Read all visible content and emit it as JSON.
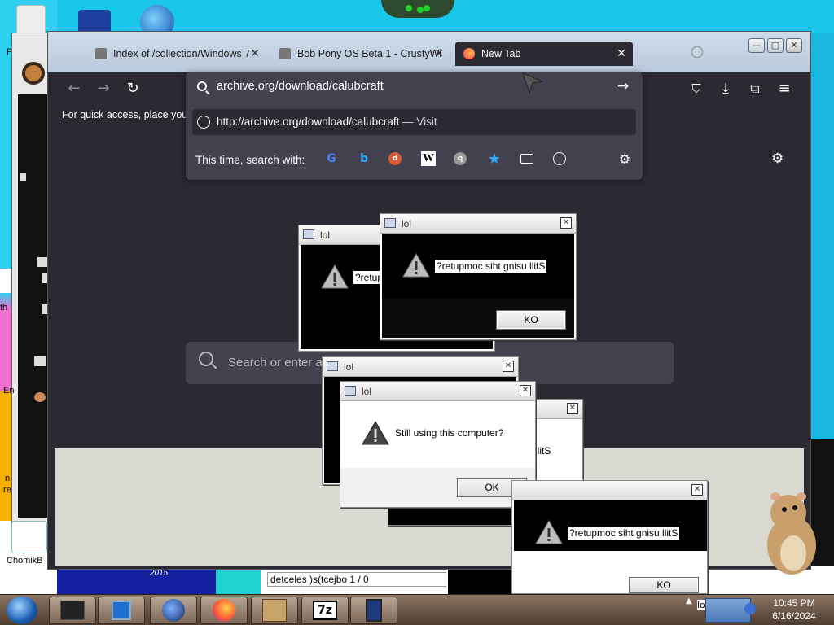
{
  "browser": {
    "tabs": [
      {
        "label": "Index of /collection/Windows 7",
        "active": false
      },
      {
        "label": "Bob Pony OS Beta 1 - CrustyWi",
        "active": false
      },
      {
        "label": "New Tab",
        "active": true
      }
    ],
    "url_value": "archive.org/download/calubcraft",
    "suggestion_url": "http://archive.org/download/calubcraft",
    "suggestion_action": "— Visit",
    "search_with_label": "This time, search with:",
    "bookmarks_hint": "For quick access, place your b",
    "newtab_search_placeholder": "Search or enter a"
  },
  "dialogs": [
    {
      "title": "lol",
      "message": "?retup"
    },
    {
      "title": "lol",
      "message": "?retupmoc siht gnisu llitS",
      "button": "KO"
    },
    {
      "title": "lol",
      "message": ""
    },
    {
      "title": "lol",
      "message": "Still using this computer?",
      "button": "OK"
    },
    {
      "title": "",
      "message": "llitS",
      "button": "KO"
    },
    {
      "title": "",
      "message": "?retupmoc siht gnisu llitS",
      "button": "KO"
    }
  ],
  "desktop": {
    "labels": {
      "chomik": "ChomikB",
      "e": "En",
      "n": "n",
      "re": "re",
      "th": "th",
      "year": "2015"
    }
  },
  "status_bar": "detceles )s(tcejbo 1 / 0",
  "taskbar": {
    "items": [
      "terminal-icon",
      "media-player-icon",
      "globe-icon",
      "firefox-icon",
      "virtualbox-icon",
      "7zip-icon",
      "tablet-icon"
    ],
    "tray_overflow": "lo",
    "clock_time": "10:45 PM",
    "clock_date": "6/16/2024"
  },
  "colors": {
    "firefox_dark": "#2b2a33",
    "firefox_toolbar": "#42414d",
    "desktop_bg": "#19c8e8",
    "taskbar": "#6a5545"
  }
}
